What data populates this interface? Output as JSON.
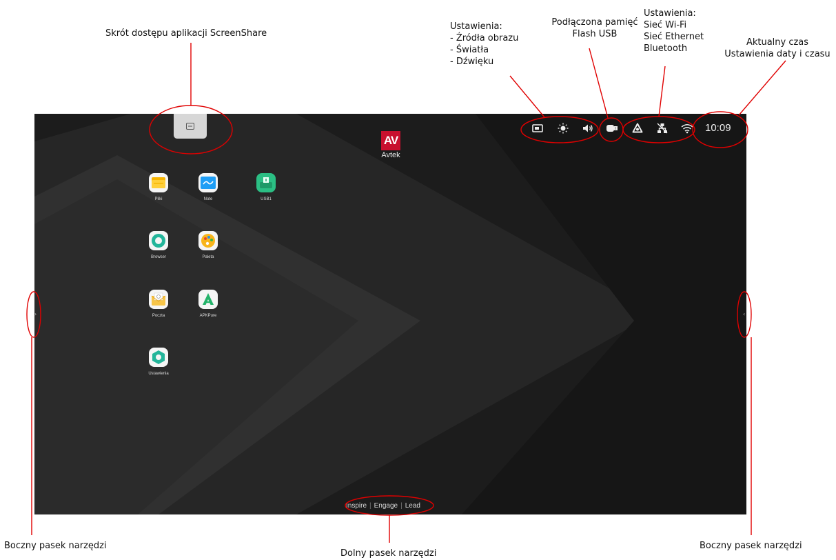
{
  "captions": {
    "screenshare": "Skrót dostępu aplikacji ScreenShare",
    "settings_source": [
      "Ustawienia:",
      "- Źródła obrazu",
      "- Światła",
      "- Dźwięku"
    ],
    "usb": [
      "Podłączona pamięć",
      "Flash USB"
    ],
    "network": [
      "Ustawienia:",
      "Sieć Wi-Fi",
      "Sieć Ethernet",
      "Bluetooth"
    ],
    "time": [
      "Aktualny czas",
      "Ustawienia daty i czasu"
    ],
    "left_sidebar": "Boczny pasek narzędzi",
    "bottom_bar": "Dolny pasek narzędzi",
    "right_sidebar": "Boczny pasek narzędzi"
  },
  "logo": {
    "mark": "AV",
    "name": "Avtek",
    "color": "#c8102e"
  },
  "status_bar": {
    "icons": [
      "source-icon",
      "brightness-icon",
      "volume-icon",
      "usb-icon",
      "bluetooth-icon",
      "ethernet-icon",
      "wifi-icon"
    ],
    "clock": "10:09"
  },
  "apps": [
    {
      "label": "Pliki",
      "icon": "folder-icon"
    },
    {
      "label": "Note",
      "icon": "note-icon"
    },
    {
      "label": "USB1",
      "icon": "usb-drive-icon"
    },
    {
      "label": "Browser",
      "icon": "browser-icon"
    },
    {
      "label": "Paleta",
      "icon": "palette-icon"
    },
    {
      "label": "Poczta",
      "icon": "mail-icon"
    },
    {
      "label": "APKPure",
      "icon": "apkpure-icon"
    },
    {
      "label": "Ustawienia",
      "icon": "settings-icon"
    }
  ],
  "bottom_bar": {
    "items": [
      "Inspire",
      "Engage",
      "Lead"
    ]
  },
  "colors": {
    "annotation": "#e00000",
    "screen_bg": "#1b1b1b"
  }
}
